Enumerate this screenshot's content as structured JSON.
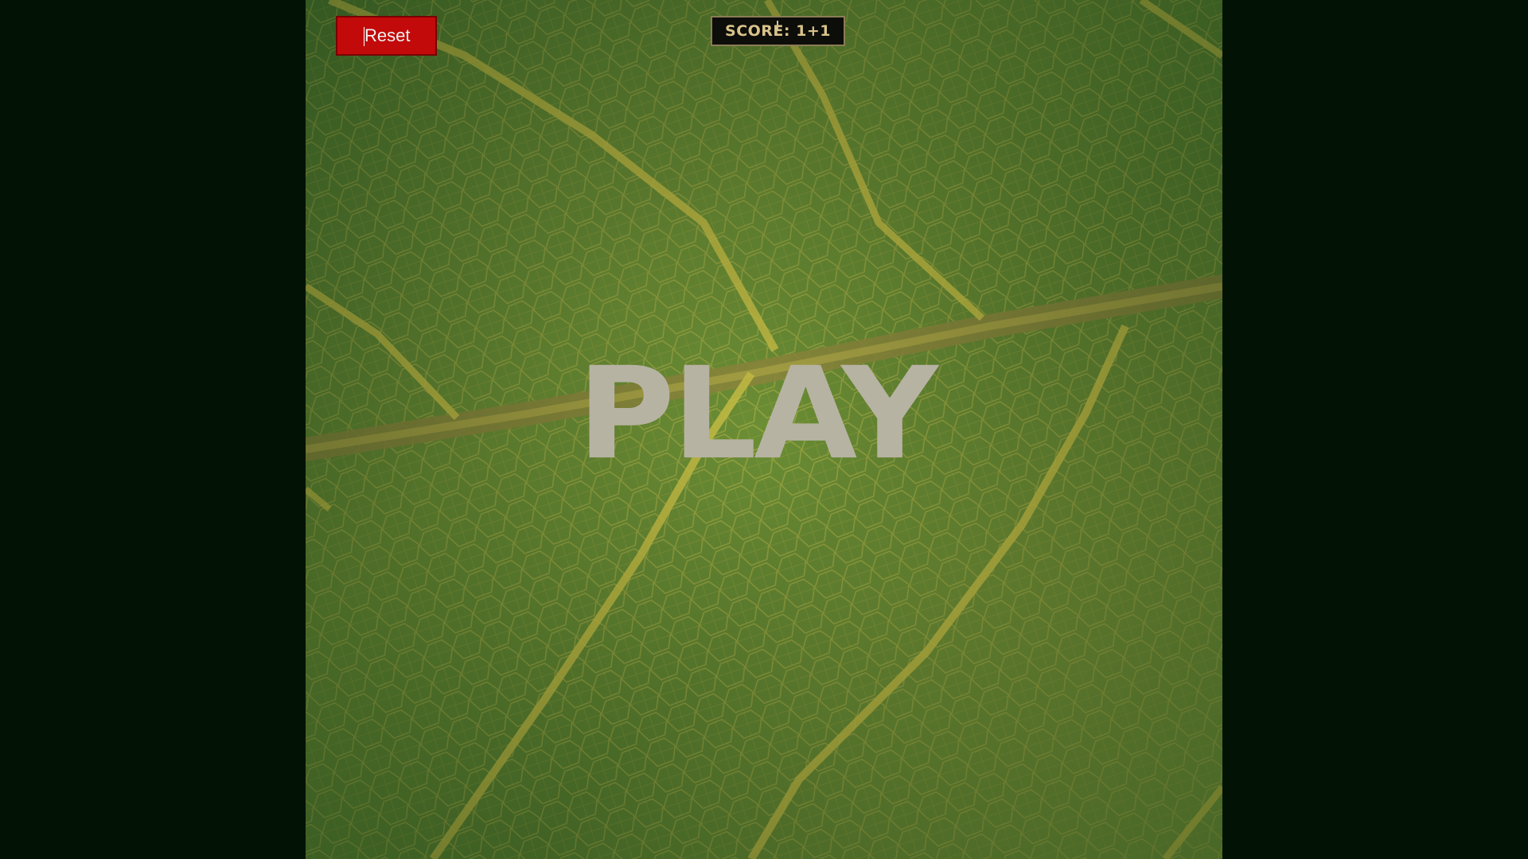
{
  "game": {
    "reset_label": "Reset",
    "score_text": "SCORE: 1+1",
    "play_label": "PLAY"
  },
  "colors": {
    "page_background": "#021205",
    "reset_button": "#c20a0a",
    "score_text": "#d9c38a",
    "play_text": "#b7b3a3"
  },
  "icons": {
    "background": "leaf-vein-image"
  }
}
